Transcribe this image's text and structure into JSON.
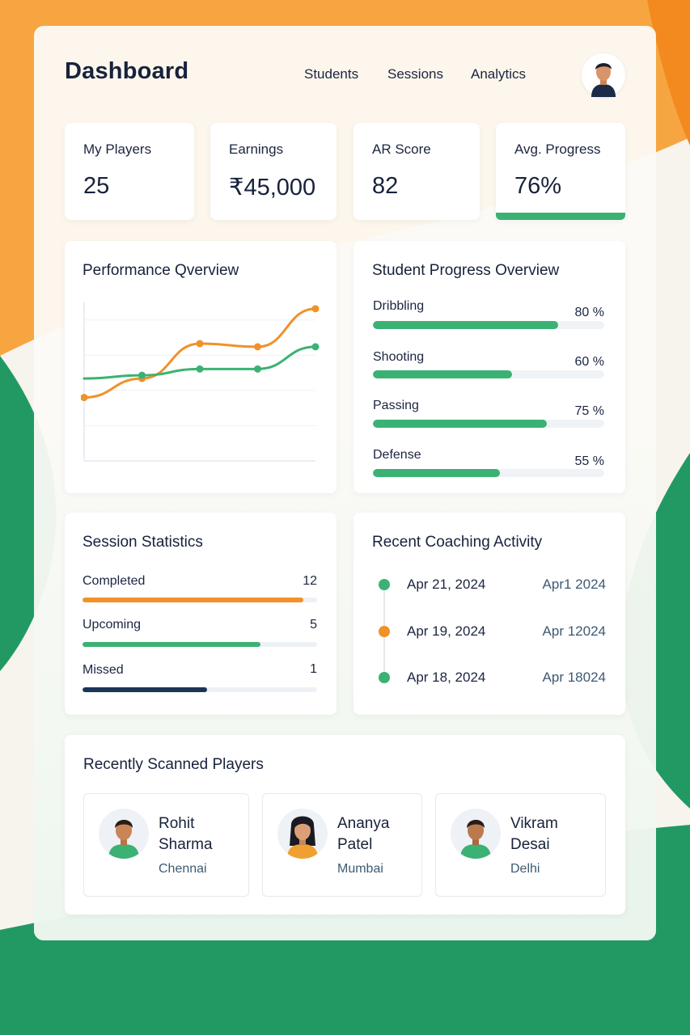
{
  "header": {
    "title": "Dashboard",
    "nav": [
      "Students",
      "Sessions",
      "Analytics"
    ],
    "avatar_icon": "user-avatar-icon"
  },
  "stats": [
    {
      "label": "My Players",
      "value": "25"
    },
    {
      "label": "Earnings",
      "value": "₹45,000"
    },
    {
      "label": "AR Score",
      "value": "82"
    },
    {
      "label": "Avg. Progress",
      "value": "76%",
      "progress_percent": 76
    }
  ],
  "performance": {
    "title": "Performance Qverview",
    "chart_data": {
      "type": "line",
      "x": [
        1,
        2,
        3,
        4,
        5
      ],
      "series": [
        {
          "values": [
            2.0,
            2.6,
            3.7,
            3.6,
            4.8
          ],
          "color": "#f0912a"
        },
        {
          "values": [
            2.6,
            2.7,
            2.9,
            2.9,
            3.6
          ],
          "color": "#3bb273"
        }
      ],
      "ylim": [
        0,
        5
      ],
      "grid": true
    }
  },
  "progress": {
    "title": "Student Progress Overview",
    "items": [
      {
        "label": "Dribbling",
        "pct_text": "80 %",
        "value": 80
      },
      {
        "label": "Shooting",
        "pct_text": "60 %",
        "value": 60
      },
      {
        "label": "Passing",
        "pct_text": "75 %",
        "value": 75
      },
      {
        "label": "Defense",
        "pct_text": "55 %",
        "value": 55
      }
    ]
  },
  "sessions": {
    "title": "Session Statistics",
    "items": [
      {
        "label": "Completed",
        "count": "12",
        "fill_fraction": 0.94,
        "color": "#f0912a"
      },
      {
        "label": "Upcoming",
        "count": "5",
        "fill_fraction": 0.76,
        "color": "#3bb273"
      },
      {
        "label": "Missed",
        "count": "1",
        "fill_fraction": 0.53,
        "color": "#1c3557"
      }
    ]
  },
  "activity": {
    "title": "Recent Coaching Activity",
    "items": [
      {
        "date": "Apr 21, 2024",
        "alt": "Apr1 2024",
        "color": "#3bb273"
      },
      {
        "date": "Apr 19, 2024",
        "alt": "Apr 12024",
        "color": "#f0912a"
      },
      {
        "date": "Apr 18, 2024",
        "alt": "Apr 18024",
        "color": "#3bb273"
      }
    ]
  },
  "players": {
    "title": "Recently Scanned Players",
    "items": [
      {
        "first": "Rohit",
        "last": "Sharma",
        "city": "Chennai",
        "shirt": "#3bb273",
        "icon": "male-avatar-icon"
      },
      {
        "first": "Ananya",
        "last": "Patel",
        "city": "Mumbai",
        "shirt": "#f0a030",
        "icon": "female-avatar-icon"
      },
      {
        "first": "Vikram",
        "last": "Desai",
        "city": "Delhi",
        "shirt": "#3bb273",
        "icon": "male-avatar-icon"
      }
    ]
  },
  "colors": {
    "saffron": "#f7a540",
    "green": "#229963",
    "accent_green": "#3bb273",
    "accent_orange": "#f0912a",
    "navy": "#1c3557"
  }
}
